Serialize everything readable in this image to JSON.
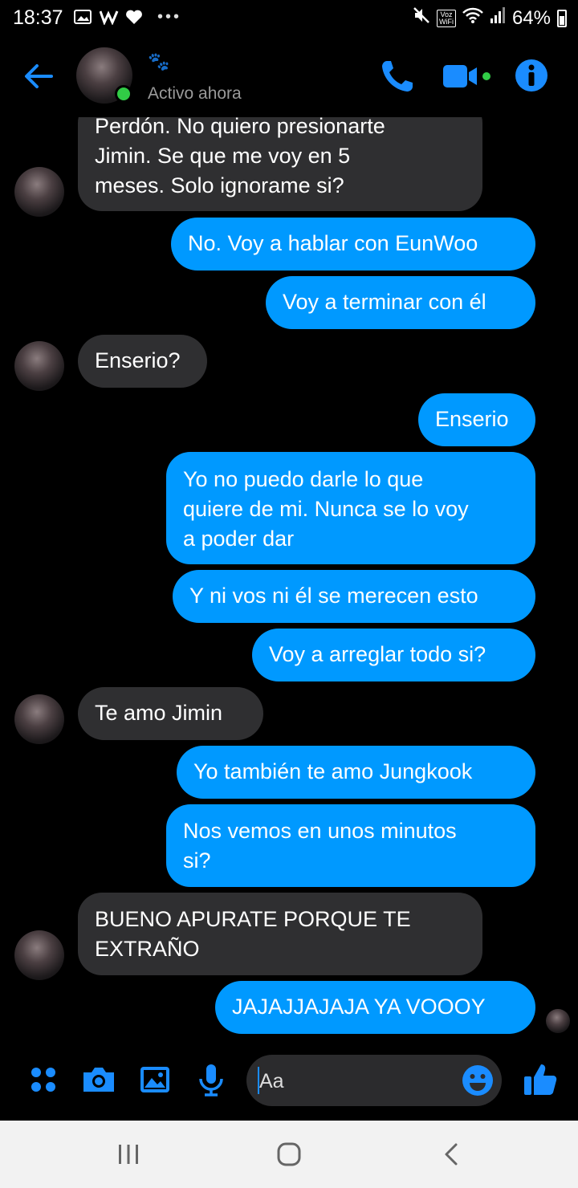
{
  "status_bar": {
    "time": "18:37",
    "dots": "•••",
    "volte_label": "Voz\nWiFi",
    "battery": "64%"
  },
  "header": {
    "emoji": "🐾",
    "status": "Activo ahora"
  },
  "messages": [
    {
      "side": "in",
      "text": "Perdón. No quiero presionarte\nJimin. Se que me voy en 5\nmeses. Solo ignorame si?"
    },
    {
      "side": "out",
      "text": "No. Voy a hablar con EunWoo"
    },
    {
      "side": "out",
      "text": "Voy a terminar con él"
    },
    {
      "side": "in",
      "text": "Enserio?"
    },
    {
      "side": "out",
      "text": "Enserio"
    },
    {
      "side": "out",
      "text": "Yo no puedo darle lo que\nquiere de mi. Nunca se lo voy\na poder dar"
    },
    {
      "side": "out",
      "text": "Y ni vos ni él se merecen esto"
    },
    {
      "side": "out",
      "text": "Voy a arreglar todo si?"
    },
    {
      "side": "in",
      "text": "Te amo Jimin"
    },
    {
      "side": "out",
      "text": "Yo también te amo Jungkook"
    },
    {
      "side": "out",
      "text": "Nos vemos en unos minutos\nsi?"
    },
    {
      "side": "in",
      "text": "BUENO APURATE PORQUE TE\nEXTRAÑO"
    },
    {
      "side": "out",
      "text": "JAJAJJAJAJA YA VOOOY"
    }
  ],
  "composer": {
    "placeholder": "Aa"
  },
  "colors": {
    "accent": "#0099ff",
    "incoming_bubble": "#2f2f31",
    "background": "#000000",
    "online": "#31cc46"
  }
}
